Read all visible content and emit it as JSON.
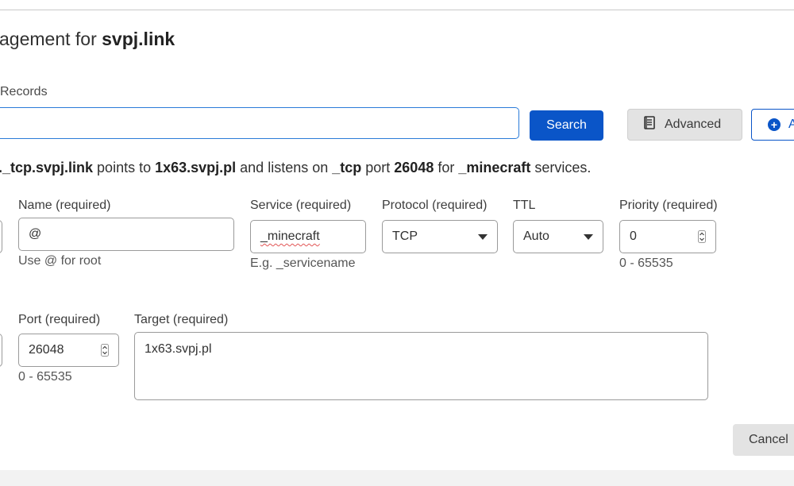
{
  "header": {
    "title_prefix": "agement for ",
    "domain": "svpj.link"
  },
  "records": {
    "section_label": "Records",
    "search": {
      "value": "",
      "placeholder": "",
      "button_label": "Search"
    },
    "advanced_label": "Advanced",
    "add_label": "A"
  },
  "summary": {
    "record_name": "._tcp.svpj.link",
    "text1": " points to ",
    "target": "1x63.svpj.pl",
    "text2": " and listens on ",
    "protocol": "_tcp",
    "text3": " port ",
    "port": "26048",
    "text4": " for ",
    "service": "_minecraft",
    "text5": " services."
  },
  "form": {
    "name": {
      "label": "Name (required)",
      "value": "@",
      "hint": "Use @ for root"
    },
    "service": {
      "label": "Service (required)",
      "value": "_minecraft",
      "hint": "E.g. _servicename"
    },
    "protocol": {
      "label": "Protocol (required)",
      "value": "TCP"
    },
    "ttl": {
      "label": "TTL",
      "value": "Auto"
    },
    "priority": {
      "label": "Priority (required)",
      "value": "0",
      "hint": "0 - 65535"
    },
    "port": {
      "label": "Port (required)",
      "value": "26048",
      "hint": "0 - 65535"
    },
    "target": {
      "label": "Target (required)",
      "value": "1x63.svpj.pl"
    },
    "cancel_label": "Cancel"
  },
  "colors": {
    "primary": "#0a55c8",
    "focus_border": "#2a7bd8",
    "secondary_button": "#e3e3e3"
  },
  "icons": {
    "advanced": "document-icon",
    "add": "plus-circle-icon",
    "select": "caret-down-icon",
    "stepper": "stepper-icon"
  }
}
